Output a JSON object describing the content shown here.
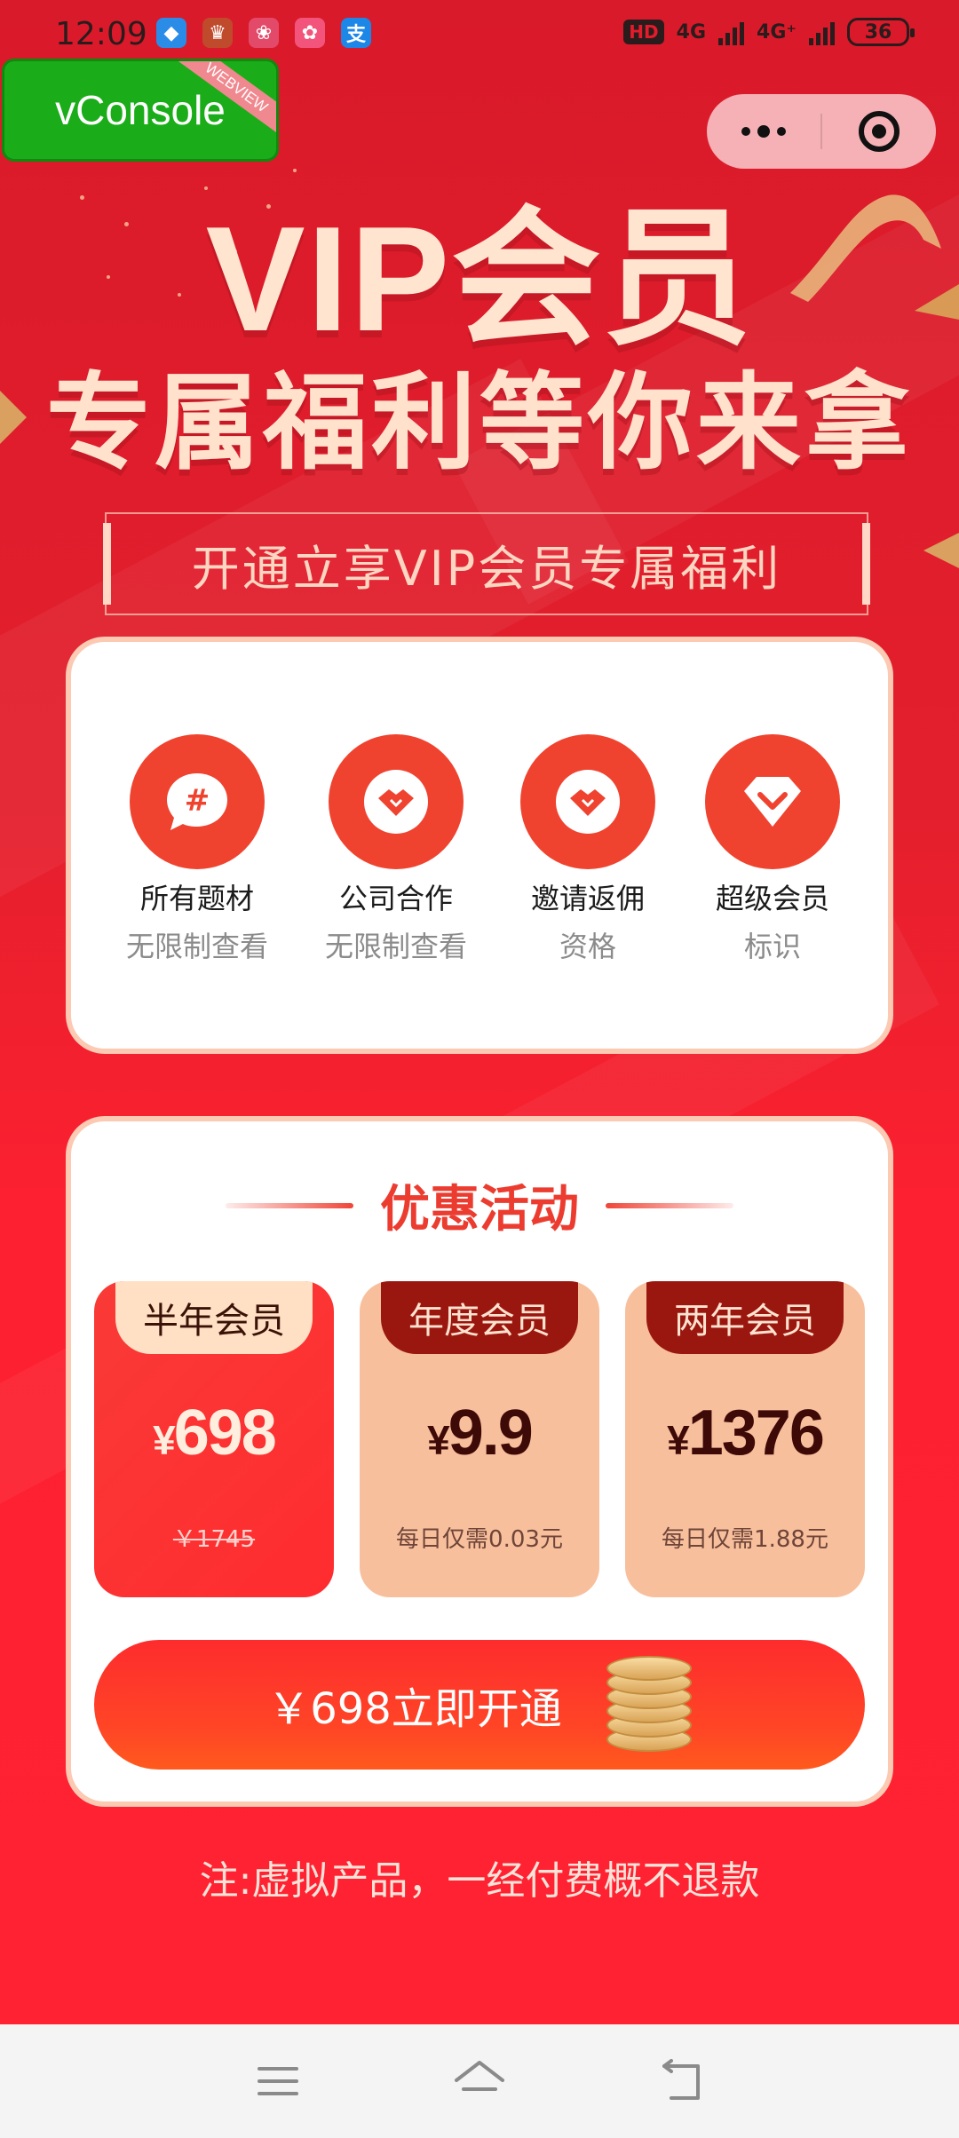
{
  "status_bar": {
    "time": "12:09",
    "apps": [
      {
        "icon": "qq-icon",
        "glyph": "◆",
        "color": "#2b8ce8"
      },
      {
        "icon": "game-icon",
        "glyph": "♛",
        "color": "#c04a2c"
      },
      {
        "icon": "app-icon",
        "glyph": "❀",
        "color": "#e34a6a"
      },
      {
        "icon": "app-icon",
        "glyph": "✿",
        "color": "#f2547b"
      },
      {
        "icon": "alipay-icon",
        "glyph": "支",
        "color": "#1d87e8"
      }
    ],
    "hd": "HD",
    "net1": "4G",
    "net2": "4G⁺",
    "battery": "36"
  },
  "vconsole": {
    "label": "vConsole",
    "ribbon": "WEBVIEW"
  },
  "hero": {
    "title": "VIP会员",
    "subtitle": "专属福利等你来拿",
    "banner": "开通立享VIP会员专属福利"
  },
  "benefits": [
    {
      "icon": "hashtag-chat-icon",
      "title": "所有题材",
      "desc": "无限制查看"
    },
    {
      "icon": "handshake-icon",
      "title": "公司合作",
      "desc": "无限制查看"
    },
    {
      "icon": "handshake-icon",
      "title": "邀请返佣",
      "desc": "资格"
    },
    {
      "icon": "diamond-icon",
      "title": "超级会员",
      "desc": "标识"
    }
  ],
  "offer": {
    "title": "优惠活动",
    "plans": [
      {
        "tag": "半年会员",
        "yen": "¥",
        "price": "698",
        "note": "￥1745",
        "selected": true
      },
      {
        "tag": "年度会员",
        "yen": "¥",
        "price": "9.9",
        "note": "每日仅需0.03元",
        "selected": false
      },
      {
        "tag": "两年会员",
        "yen": "¥",
        "price": "1376",
        "note": "每日仅需1.88元",
        "selected": false
      }
    ],
    "cta": "￥698立即开通"
  },
  "notice": "注:虚拟产品，一经付费概不退款",
  "colors": {
    "accent": "#ec3c30",
    "brand_red": "#e31b2b",
    "card_border": "#fcc9b2"
  }
}
